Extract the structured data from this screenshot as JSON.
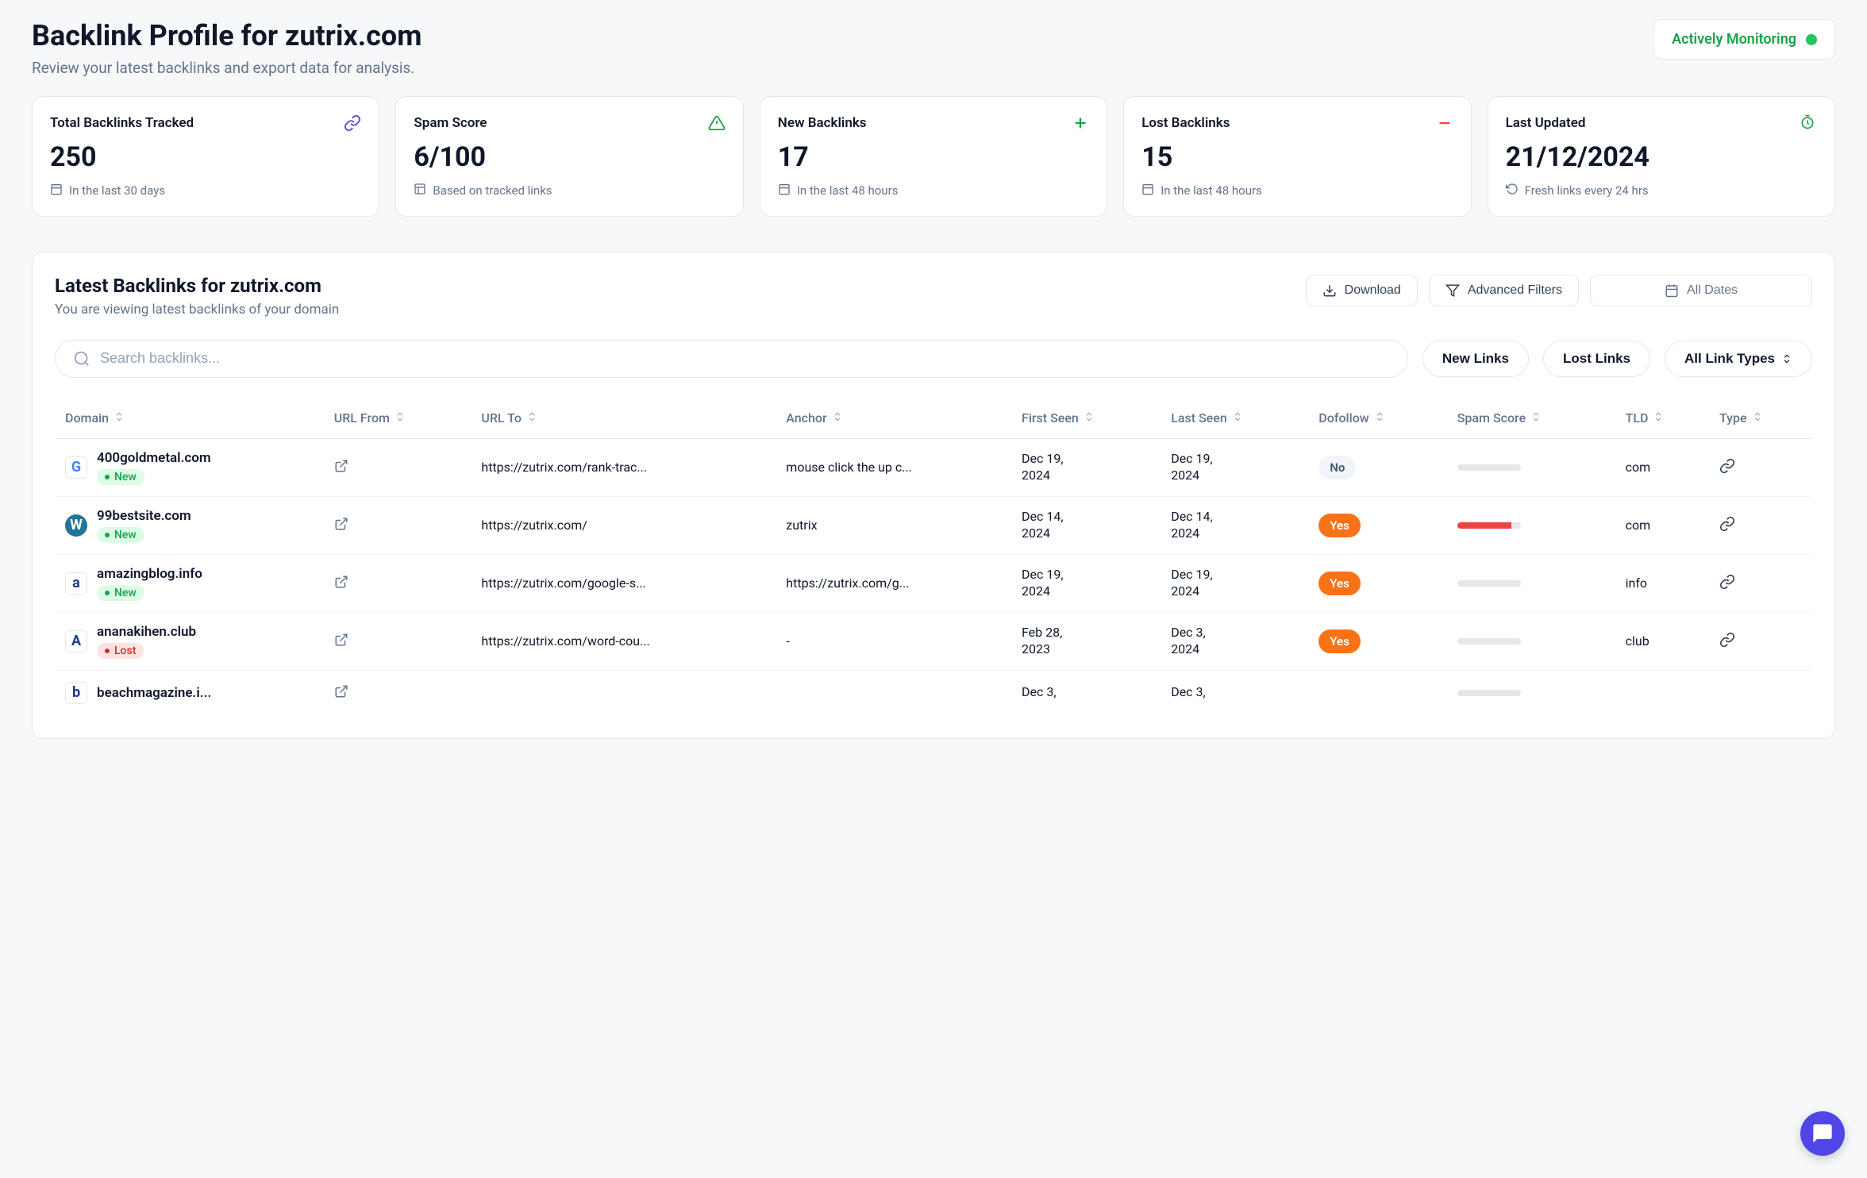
{
  "header": {
    "title": "Backlink Profile for zutrix.com",
    "subtitle": "Review your latest backlinks and export data for analysis.",
    "monitor_label": "Actively Monitoring"
  },
  "stats": [
    {
      "label": "Total Backlinks Tracked",
      "value": "250",
      "note": "In the last 30 days",
      "icon": "link",
      "icon_color": "#4f46e5"
    },
    {
      "label": "Spam Score",
      "value": "6/100",
      "note": "Based on tracked links",
      "icon": "alert",
      "icon_color": "#16a34a",
      "note_icon": "grid"
    },
    {
      "label": "New Backlinks",
      "value": "17",
      "note": "In the last 48 hours",
      "icon": "plus",
      "icon_color": "#16a34a"
    },
    {
      "label": "Lost Backlinks",
      "value": "15",
      "note": "In the last 48 hours",
      "icon": "minus",
      "icon_color": "#ef4444"
    },
    {
      "label": "Last Updated",
      "value": "21/12/2024",
      "note": "Fresh links every 24 hrs",
      "icon": "timer",
      "icon_color": "#16a34a",
      "note_icon": "refresh"
    }
  ],
  "panel": {
    "title": "Latest Backlinks for zutrix.com",
    "subtitle": "You are viewing latest backlinks of your domain",
    "download_label": "Download",
    "filters_label": "Advanced Filters",
    "dates_label": "All Dates",
    "search_placeholder": "Search backlinks...",
    "new_links_label": "New Links",
    "lost_links_label": "Lost Links",
    "all_types_label": "All Link Types"
  },
  "columns": [
    "Domain",
    "URL From",
    "URL To",
    "Anchor",
    "First Seen",
    "Last Seen",
    "Dofollow",
    "Spam Score",
    "TLD",
    "Type"
  ],
  "rows": [
    {
      "favicon_letter": "G",
      "favicon_bg": "#ffffff",
      "favicon_color": "#4285f4",
      "domain": "400goldmetal.com",
      "status": "New",
      "url_to": "https://zutrix.com/rank-trac...",
      "anchor": "mouse click the up c...",
      "first_seen": "Dec 19, 2024",
      "last_seen": "Dec 19, 2024",
      "dofollow": "No",
      "spam_pct": 0,
      "tld": "com"
    },
    {
      "favicon_letter": "W",
      "favicon_bg": "#21759b",
      "favicon_color": "#ffffff",
      "favicon_round": true,
      "domain": "99bestsite.com",
      "status": "New",
      "url_to": "https://zutrix.com/",
      "anchor": "zutrix",
      "first_seen": "Dec 14, 2024",
      "last_seen": "Dec 14, 2024",
      "dofollow": "Yes",
      "spam_pct": 85,
      "tld": "com"
    },
    {
      "favicon_letter": "a",
      "favicon_bg": "#ffffff",
      "favicon_color": "#1e3a8a",
      "domain": "amazingblog.info",
      "status": "New",
      "url_to": "https://zutrix.com/google-s...",
      "anchor": "https://zutrix.com/g...",
      "first_seen": "Dec 19, 2024",
      "last_seen": "Dec 19, 2024",
      "dofollow": "Yes",
      "spam_pct": 0,
      "tld": "info"
    },
    {
      "favicon_letter": "A",
      "favicon_bg": "#ffffff",
      "favicon_color": "#1e3a8a",
      "domain": "ananakihen.club",
      "status": "Lost",
      "url_to": "https://zutrix.com/word-cou...",
      "anchor": "-",
      "first_seen": "Feb 28, 2023",
      "last_seen": "Dec 3, 2024",
      "dofollow": "Yes",
      "spam_pct": 0,
      "tld": "club"
    },
    {
      "favicon_letter": "b",
      "favicon_bg": "#ffffff",
      "favicon_color": "#1e3a8a",
      "domain": "beachmagazine.i...",
      "status": "",
      "url_to": "",
      "anchor": "",
      "first_seen": "Dec 3,",
      "last_seen": "Dec 3,",
      "dofollow": "",
      "spam_pct": 0,
      "tld": ""
    }
  ]
}
